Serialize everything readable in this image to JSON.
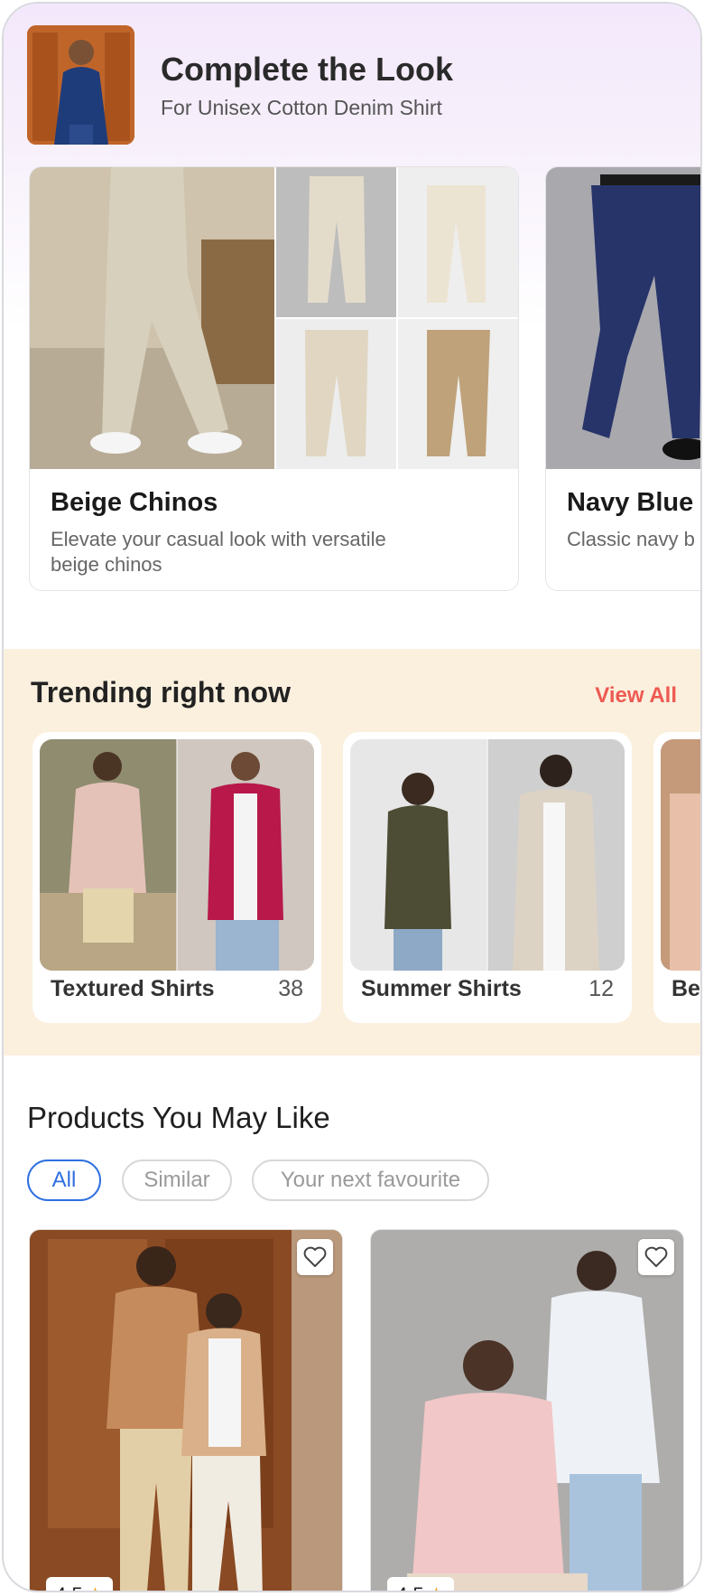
{
  "header": {
    "title": "Complete the Look",
    "subtitle": "For Unisex Cotton Denim Shirt"
  },
  "looks": [
    {
      "title": "Beige Chinos",
      "description": "Elevate your casual look with versatile beige chinos"
    },
    {
      "title": "Navy Blue T",
      "description": "Classic navy b appearance at"
    }
  ],
  "trending": {
    "title": "Trending right now",
    "view_all": "View All",
    "items": [
      {
        "label": "Textured Shirts",
        "count": "38"
      },
      {
        "label": "Summer Shirts",
        "count": "12"
      },
      {
        "label": "Bea",
        "count": ""
      }
    ]
  },
  "products": {
    "title": "Products You May Like",
    "chips": [
      "All",
      "Similar",
      "Your next favourite"
    ],
    "active_chip": "All",
    "items": [
      {
        "rating": "4.5"
      },
      {
        "rating": "4.5"
      }
    ]
  },
  "colors": {
    "accent_link": "#ee5a52",
    "chip_active": "#2f6fe0",
    "star": "#f2a51a",
    "trending_bg": "#fbf0de"
  },
  "icons": [
    "heart-icon",
    "star-icon"
  ]
}
